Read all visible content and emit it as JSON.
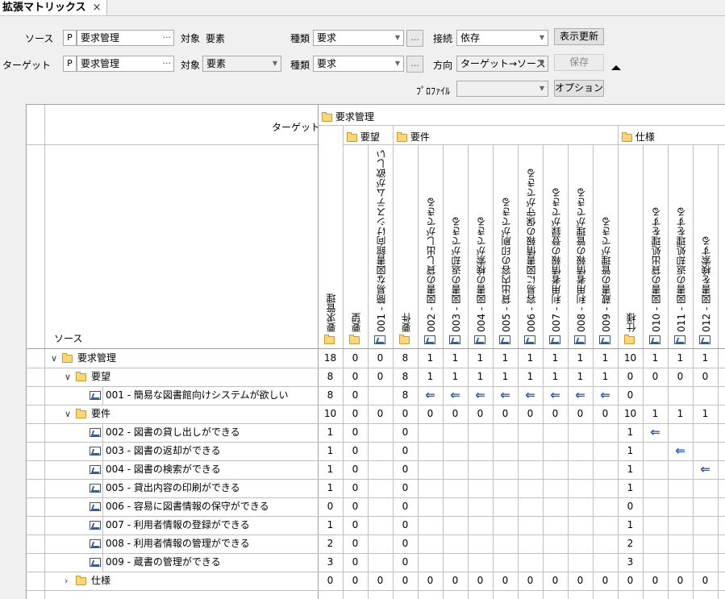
{
  "tab": {
    "title": "拡張マトリックス",
    "close": "×"
  },
  "row1": {
    "source_label": "ソース",
    "source_p": "P",
    "source_value": "要求管理",
    "target_kind_label": "対象",
    "target_kind_value": "要素",
    "type_label": "種類",
    "type_value": "要求",
    "connect_label": "接続",
    "connect_value": "依存",
    "refresh_button": "表示更新"
  },
  "row2": {
    "target_label": "ターゲット",
    "target_p": "P",
    "target_value": "要求管理",
    "target_kind_label": "対象",
    "target_kind_value": "要素",
    "type_label": "種類",
    "type_value": "要求",
    "direction_label": "方向",
    "direction_value": "ターゲット→ソース",
    "save_button": "保存"
  },
  "row3": {
    "profile_label": "ﾌﾟﾛﾌｧｲﾙ",
    "profile_value": "",
    "option_button": "オプション"
  },
  "matrix": {
    "target_caption": "ターゲット",
    "source_caption": "ソース",
    "top_group": "要求管理",
    "groups": [
      "要望",
      "要件",
      "仕様"
    ],
    "columns": [
      "要求管理",
      "要望",
      "001 - 簡易な図書館向けシステムが欲しい",
      "要件",
      "002 - 図書の貸し出しができる",
      "003 - 図書の返却ができる",
      "004 - 図書の検索ができる",
      "005 - 貸出内容の印刷ができる",
      "006 - 容易に図書情報の保守ができる",
      "007 - 利用者情報の登録ができる",
      "008 - 利用者情報の管理ができる",
      "009 - 蔵書の管理ができる",
      "仕様",
      "010 - 図書の貸出処理をする",
      "011 - 図書の返却処理をする",
      "012 - 図書を検索する"
    ],
    "rows": [
      {
        "label": "要求管理",
        "kind": "folder",
        "indent": 0,
        "chev": "∨",
        "values": [
          "18",
          "0",
          "0",
          "8",
          "1",
          "1",
          "1",
          "1",
          "1",
          "1",
          "1",
          "1",
          "10",
          "1",
          "1",
          "1"
        ]
      },
      {
        "label": "要望",
        "kind": "folder",
        "indent": 1,
        "chev": "∨",
        "values": [
          "8",
          "0",
          "0",
          "8",
          "1",
          "1",
          "1",
          "1",
          "1",
          "1",
          "1",
          "1",
          "0",
          "0",
          "0",
          "0"
        ]
      },
      {
        "label": "001 - 簡易な図書館向けシステムが欲しい",
        "kind": "req",
        "indent": 2,
        "chev": "",
        "values": [
          "8",
          "0",
          "",
          "8",
          "⇐",
          "⇐",
          "⇐",
          "⇐",
          "⇐",
          "⇐",
          "⇐",
          "⇐",
          "0",
          "",
          "",
          ""
        ]
      },
      {
        "label": "要件",
        "kind": "folder",
        "indent": 1,
        "chev": "∨",
        "values": [
          "10",
          "0",
          "0",
          "0",
          "0",
          "0",
          "0",
          "0",
          "0",
          "0",
          "0",
          "0",
          "10",
          "1",
          "1",
          "1"
        ]
      },
      {
        "label": "002 - 図書の貸し出しができる",
        "kind": "req",
        "indent": 2,
        "chev": "",
        "values": [
          "1",
          "0",
          "",
          "0",
          "",
          "",
          "",
          "",
          "",
          "",
          "",
          "",
          "1",
          "⇐",
          "",
          ""
        ]
      },
      {
        "label": "003 - 図書の返却ができる",
        "kind": "req",
        "indent": 2,
        "chev": "",
        "values": [
          "1",
          "0",
          "",
          "0",
          "",
          "",
          "",
          "",
          "",
          "",
          "",
          "",
          "1",
          "",
          "⇐",
          ""
        ]
      },
      {
        "label": "004 - 図書の検索ができる",
        "kind": "req",
        "indent": 2,
        "chev": "",
        "values": [
          "1",
          "0",
          "",
          "0",
          "",
          "",
          "",
          "",
          "",
          "",
          "",
          "",
          "1",
          "",
          "",
          "⇐"
        ]
      },
      {
        "label": "005 - 貸出内容の印刷ができる",
        "kind": "req",
        "indent": 2,
        "chev": "",
        "values": [
          "1",
          "0",
          "",
          "0",
          "",
          "",
          "",
          "",
          "",
          "",
          "",
          "",
          "1",
          "",
          "",
          ""
        ]
      },
      {
        "label": "006 - 容易に図書情報の保守ができる",
        "kind": "req",
        "indent": 2,
        "chev": "",
        "values": [
          "0",
          "0",
          "",
          "0",
          "",
          "",
          "",
          "",
          "",
          "",
          "",
          "",
          "0",
          "",
          "",
          ""
        ]
      },
      {
        "label": "007 - 利用者情報の登録ができる",
        "kind": "req",
        "indent": 2,
        "chev": "",
        "values": [
          "1",
          "0",
          "",
          "0",
          "",
          "",
          "",
          "",
          "",
          "",
          "",
          "",
          "1",
          "",
          "",
          ""
        ]
      },
      {
        "label": "008 - 利用者情報の管理ができる",
        "kind": "req",
        "indent": 2,
        "chev": "",
        "values": [
          "2",
          "0",
          "",
          "0",
          "",
          "",
          "",
          "",
          "",
          "",
          "",
          "",
          "2",
          "",
          "",
          ""
        ]
      },
      {
        "label": "009 - 蔵書の管理ができる",
        "kind": "req",
        "indent": 2,
        "chev": "",
        "values": [
          "3",
          "0",
          "",
          "0",
          "",
          "",
          "",
          "",
          "",
          "",
          "",
          "",
          "3",
          "",
          "",
          ""
        ]
      },
      {
        "label": "仕様",
        "kind": "folder",
        "indent": 1,
        "chev": "›",
        "values": [
          "0",
          "0",
          "0",
          "0",
          "0",
          "0",
          "0",
          "0",
          "0",
          "0",
          "0",
          "0",
          "0",
          "0",
          "0",
          "0"
        ]
      }
    ]
  }
}
